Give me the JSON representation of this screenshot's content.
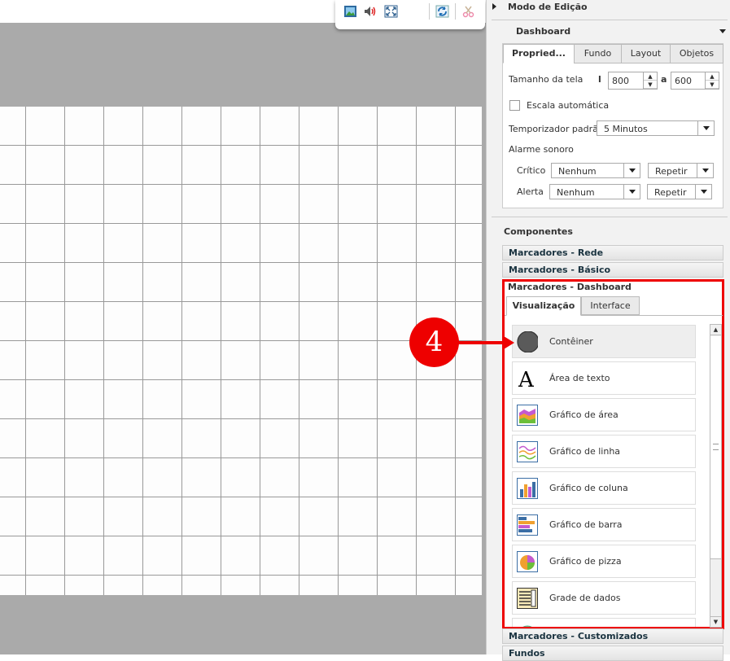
{
  "panel": {
    "title": "Modo de Edição",
    "section": "Dashboard"
  },
  "tabs": [
    "Propried...",
    "Fundo",
    "Layout",
    "Objetos"
  ],
  "props": {
    "screen_size_label": "Tamanho da tela",
    "width_prefix": "l",
    "width": "800",
    "sep": "a",
    "height": "600",
    "auto_scale": "Escala automática",
    "timer_label": "Temporizador padrão",
    "timer_value": "5 Minutos",
    "alarm_label": "Alarme sonoro",
    "critical_label": "Crítico",
    "critical_sound": "Nenhum",
    "critical_repeat": "Repetir",
    "alert_label": "Alerta",
    "alert_sound": "Nenhum",
    "alert_repeat": "Repetir"
  },
  "components": {
    "title": "Componentes",
    "groups": [
      "Marcadores - Rede",
      "Marcadores - Básico",
      "Marcadores - Dashboard",
      "Marcadores - Customizados",
      "Fundos"
    ],
    "subtabs": [
      "Visualização",
      "Interface"
    ],
    "items": [
      "Contêiner",
      "Área de texto",
      "Gráfico de área",
      "Gráfico de linha",
      "Gráfico de coluna",
      "Gráfico de barra",
      "Gráfico de pizza",
      "Grade de dados"
    ]
  },
  "callout": "4"
}
